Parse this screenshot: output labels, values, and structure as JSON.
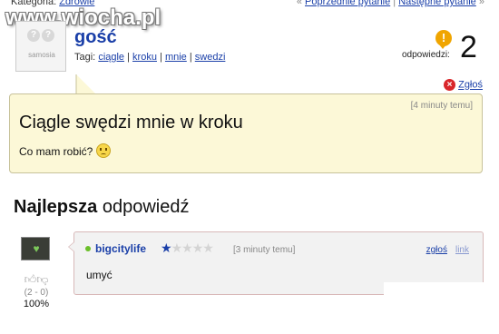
{
  "topbar": {
    "category_label": "Kategoria:",
    "category_link": "Zdrowie",
    "prev_label": "Poprzednie pytanie",
    "separator": "|",
    "next_label": "Następne pytanie",
    "prev_arrows": "«",
    "next_arrows": "»"
  },
  "watermark": "www.wiocha.pl",
  "question": {
    "avatar_brand": "samosia",
    "author": "gość",
    "tags_label": "Tagi:",
    "tags": [
      "ciągle",
      "kroku",
      "mnie",
      "swedzi"
    ],
    "answers_label": "odpowiedzi:",
    "answers_count": "2",
    "report_label": "Zgłoś",
    "time": "[4 minuty temu]",
    "title": "Ciągle swędzi mnie w kroku",
    "body": "Co mam robić?"
  },
  "best_answer": {
    "heading_bold": "Najlepsza",
    "heading_rest": "odpowiedź",
    "author": "bigcitylife",
    "stars_filled": 1,
    "stars_total": 5,
    "time": "[3 minuty temu]",
    "report_label": "zgłoś",
    "link_label": "link",
    "text": "umyć",
    "votes_ratio": "(2 - 0)",
    "votes_percent": "100%"
  },
  "colors": {
    "link": "#1a3fa8",
    "question_bg": "#fcf8d7",
    "answer_bg": "#f2f2f2",
    "answers_icon": "#f0a500",
    "report_icon": "#d9262a",
    "online_dot": "#6bbf2a"
  }
}
